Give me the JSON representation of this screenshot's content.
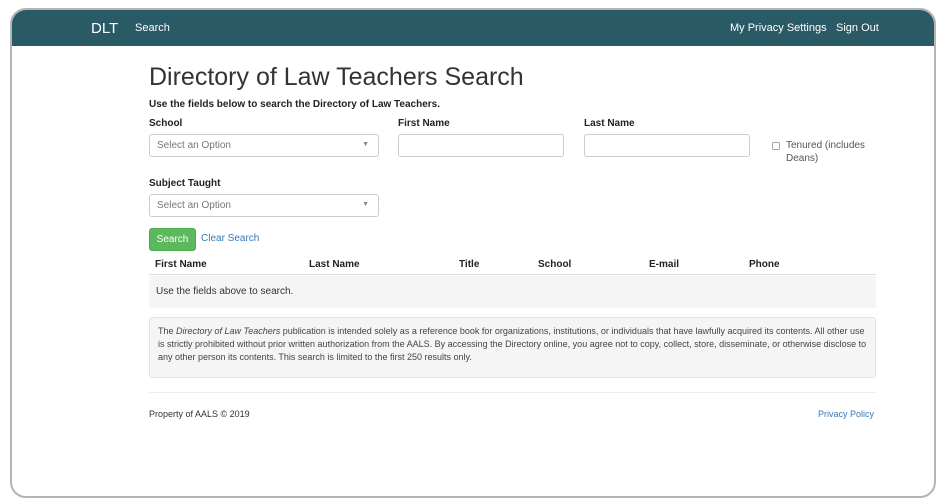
{
  "navbar": {
    "brand": "DLT",
    "search_link": "Search",
    "privacy_link": "My Privacy Settings",
    "signout_link": "Sign Out",
    "background_color": "#2a5a66"
  },
  "page": {
    "title": "Directory of Law Teachers Search",
    "intro": "Use the fields below to search the Directory of Law Teachers."
  },
  "form": {
    "school_label": "School",
    "school_select_value": "Select an Option",
    "first_name_label": "First Name",
    "first_name_value": "",
    "last_name_label": "Last Name",
    "last_name_value": "",
    "tenured_label": "Tenured (includes Deans)",
    "tenured_checked": false,
    "subject_label": "Subject Taught",
    "subject_select_value": "Select an Option",
    "search_button": "Search",
    "clear_link": "Clear Search",
    "search_button_color": "#5cb85c"
  },
  "table": {
    "columns": [
      "First Name",
      "Last Name",
      "Title",
      "School",
      "E-mail",
      "Phone"
    ],
    "empty_message": "Use the fields above to search."
  },
  "notice": {
    "before": "The ",
    "publication_name": "Directory of Law Teachers",
    "after": " publication is intended solely as a reference book for organizations, institutions, or individuals that have lawfully acquired its contents. All other use is strictly prohibited without prior written authorization from the AALS. By accessing the Directory online, you agree not to copy, collect, store, disseminate, or otherwise disclose to any other person its contents. This search is limited to the first 250 results only."
  },
  "footer": {
    "copyright": "Property of AALS © 2019",
    "privacy_link": "Privacy Policy"
  }
}
